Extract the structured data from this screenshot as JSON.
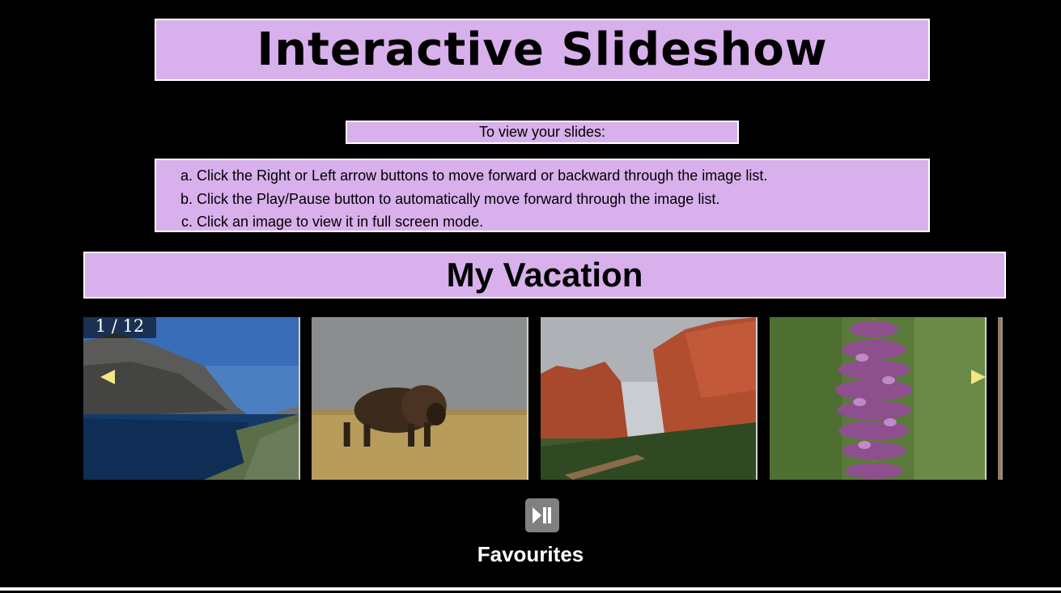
{
  "header": {
    "title": "Interactive Slideshow"
  },
  "intro": {
    "text": "To view your slides:"
  },
  "instructions": {
    "items": [
      "Click the Right or Left arrow buttons to move forward or backward through the image list.",
      "Click the Play/Pause button to automatically move forward through the image list.",
      "Click an image to view it in full screen mode."
    ]
  },
  "album": {
    "title": "My Vacation"
  },
  "slideshow": {
    "counter": "1 / 12",
    "current": 1,
    "total": 12,
    "prev_icon": "left-triangle-icon",
    "next_icon": "right-triangle-icon",
    "arrow_color": "#f2e784",
    "slides": [
      {
        "subject": "mountain lake"
      },
      {
        "subject": "bison on prairie"
      },
      {
        "subject": "red rock formations"
      },
      {
        "subject": "purple wildflower"
      }
    ]
  },
  "controls": {
    "play_pause_icon": "play-pause-icon"
  },
  "favourites": {
    "label": "Favourites"
  },
  "colors": {
    "panel": "#d8b0ec",
    "background": "#000000",
    "border": "#ffffff",
    "button": "#808080"
  }
}
